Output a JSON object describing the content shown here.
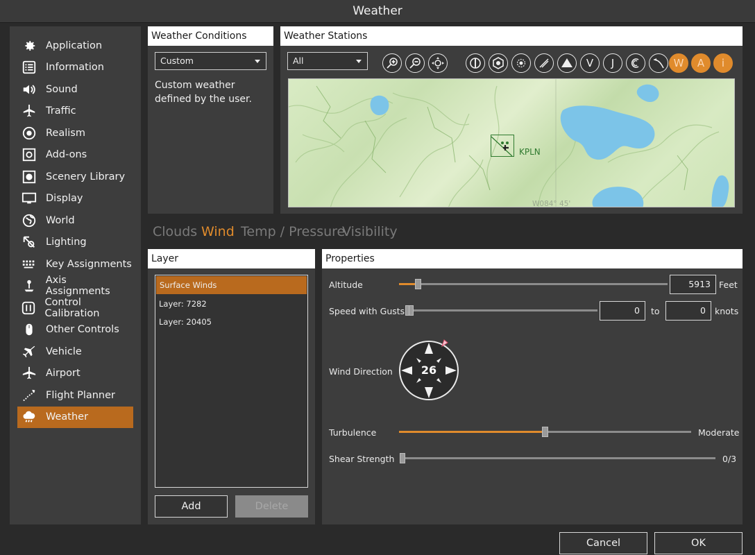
{
  "window": {
    "title": "Weather"
  },
  "sidebar": {
    "items": [
      {
        "label": "Application",
        "icon": "gear-icon"
      },
      {
        "label": "Information",
        "icon": "list-icon"
      },
      {
        "label": "Sound",
        "icon": "speaker-icon"
      },
      {
        "label": "Traffic",
        "icon": "traffic-icon"
      },
      {
        "label": "Realism",
        "icon": "realism-icon"
      },
      {
        "label": "Add-ons",
        "icon": "addons-icon"
      },
      {
        "label": "Scenery Library",
        "icon": "scenery-icon"
      },
      {
        "label": "Display",
        "icon": "monitor-icon"
      },
      {
        "label": "World",
        "icon": "globe-icon"
      },
      {
        "label": "Lighting",
        "icon": "lighting-icon"
      },
      {
        "label": "Key Assignments",
        "icon": "keyboard-icon"
      },
      {
        "label": "Axis Assignments",
        "icon": "joystick-icon"
      },
      {
        "label": "Control Calibration",
        "icon": "calibration-icon"
      },
      {
        "label": "Other Controls",
        "icon": "mouse-icon"
      },
      {
        "label": "Vehicle",
        "icon": "plane-icon"
      },
      {
        "label": "Airport",
        "icon": "airport-icon"
      },
      {
        "label": "Flight Planner",
        "icon": "flight-planner-icon"
      },
      {
        "label": "Weather",
        "icon": "weather-icon",
        "active": true
      }
    ]
  },
  "conditions": {
    "header": "Weather Conditions",
    "selected": "Custom",
    "description": "Custom weather defined by the user."
  },
  "stations": {
    "header": "Weather Stations",
    "filter": "All",
    "toolbar_glyphs": [
      "V",
      "J",
      "W",
      "A",
      "i"
    ],
    "map_label": "KPLN",
    "map_coord": "W084° 45'"
  },
  "tabs": [
    {
      "label": "Clouds",
      "active": false
    },
    {
      "label": "Wind",
      "active": true
    },
    {
      "label": "Temp / Pressure",
      "active": false
    },
    {
      "label": "Visibility",
      "active": false
    }
  ],
  "layer": {
    "header": "Layer",
    "items": [
      "Surface Winds",
      "Layer: 7282",
      "Layer: 20405"
    ],
    "selected_index": 0,
    "add_label": "Add",
    "delete_label": "Delete"
  },
  "properties": {
    "header": "Properties",
    "altitude": {
      "label": "Altitude",
      "value": "5913",
      "unit": "Feet",
      "level": 0.04
    },
    "speed": {
      "label": "Speed with Gusts",
      "from": "0",
      "to_label": "to",
      "to": "0",
      "unit": "knots",
      "level": 0.0
    },
    "direction": {
      "label": "Wind Direction",
      "value": "26"
    },
    "turbulence": {
      "label": "Turbulence",
      "value": "Moderate",
      "level": 0.5
    },
    "shear": {
      "label": "Shear Strength",
      "value": "0/3",
      "level": 0.0
    }
  },
  "footer": {
    "cancel_label": "Cancel",
    "ok_label": "OK"
  },
  "colors": {
    "accent": "#e08b2c",
    "selection": "#b96a1e",
    "panel": "#3d3d3d",
    "background": "#2a2a2a"
  }
}
